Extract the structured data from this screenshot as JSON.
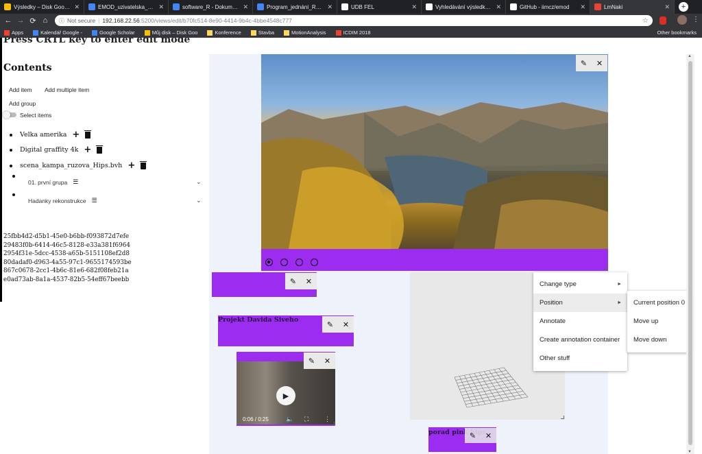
{
  "browser": {
    "tabs": [
      {
        "title": "Výsledky – Disk Google",
        "color": "#fbbc04"
      },
      {
        "title": "EMOD_uzivatelska_doku",
        "color": "#4285f4"
      },
      {
        "title": "software_R - Dokumenty",
        "color": "#4285f4"
      },
      {
        "title": "Program_jednání_RRIIM",
        "color": "#4285f4"
      },
      {
        "title": "UDB FEL",
        "color": "#ffffff"
      },
      {
        "title": "Vyhledávání výsledků - V",
        "color": "#ffffff"
      },
      {
        "title": "GitHub - iimcz/emod",
        "color": "#ffffff"
      },
      {
        "title": "LmNaki",
        "color": "#ea4335"
      }
    ],
    "tab_close": "✕",
    "new_tab": "+",
    "back": "←",
    "forward": "→",
    "reload": "⟳",
    "home": "⌂",
    "security": "Not secure",
    "url_host": "192.168.22.56",
    "url_path": ":5200/views/edit/b70fc514-8e90-4414-9b4c-4bbe4548c777",
    "star": "☆",
    "bookmarks": [
      {
        "label": "Apps",
        "color": "#ea4335"
      },
      {
        "label": "Kalendář Google -",
        "color": "#4285f4"
      },
      {
        "label": "Google Scholar",
        "color": "#4285f4"
      },
      {
        "label": "Můj disk – Disk Goo",
        "color": "#fbbc04"
      },
      {
        "label": "Konference",
        "color": "#fdd663"
      },
      {
        "label": "Stavba",
        "color": "#fdd663"
      },
      {
        "label": "MotionAnalysis",
        "color": "#fdd663"
      },
      {
        "label": "ICDIM 2018",
        "color": "#ea4335"
      }
    ],
    "other_bookmarks": "Other bookmarks"
  },
  "sidebar": {
    "hint": "Press CRTL key to enter edit mode",
    "heading": "Contents",
    "add_item": "Add item",
    "add_multiple": "Add multiple item",
    "add_group": "Add group",
    "select_items": "Select items",
    "items": [
      {
        "label": "Velka amerika"
      },
      {
        "label": "Digital graffity 4k"
      },
      {
        "label": "scena_kampa_ruzova_Hips.bvh"
      }
    ],
    "groups": [
      {
        "label": "01. první grupa"
      },
      {
        "label": "Hadanky rekonstrukce"
      }
    ],
    "ids": [
      "25fbb4d2-d5b1-45e0-b6bb-f093872d7efe",
      "29483f0b-6414-46c5-8128-e33a381f6964",
      "2954f31e-5dcc-4538-a65b-5151108ef2d8",
      "80dadaf0-d963-4a55-97c1-9655174593be",
      "867c0678-2cc1-4b6c-81e6-682f08feb21a",
      "e0ad73ab-8a1a-4537-82b5-54eff67beebb"
    ]
  },
  "canvas": {
    "image_slides": 4,
    "selected_slide": 0,
    "panel_title": "Projekt Davida Siveho",
    "panel_bottom_title": "porad pink hips",
    "video": {
      "time": "0:06 / 0:25",
      "progress": 0.24,
      "play_icon": "▶",
      "volume_icon": "🔈",
      "fullscreen_icon": "⛶",
      "more_icon": "⋮"
    },
    "edit_icon": "✎",
    "close_icon": "✕"
  },
  "context_menu": {
    "items": [
      {
        "label": "Change type",
        "submenu": true
      },
      {
        "label": "Position",
        "submenu": true
      },
      {
        "label": "Annotate",
        "submenu": false
      },
      {
        "label": "Create annotation container",
        "submenu": false
      },
      {
        "label": "Other stuff",
        "submenu": false
      }
    ],
    "arrow": "►",
    "submenu": [
      {
        "label": "Current position 0"
      },
      {
        "label": "Move up"
      },
      {
        "label": "Move down"
      }
    ]
  }
}
